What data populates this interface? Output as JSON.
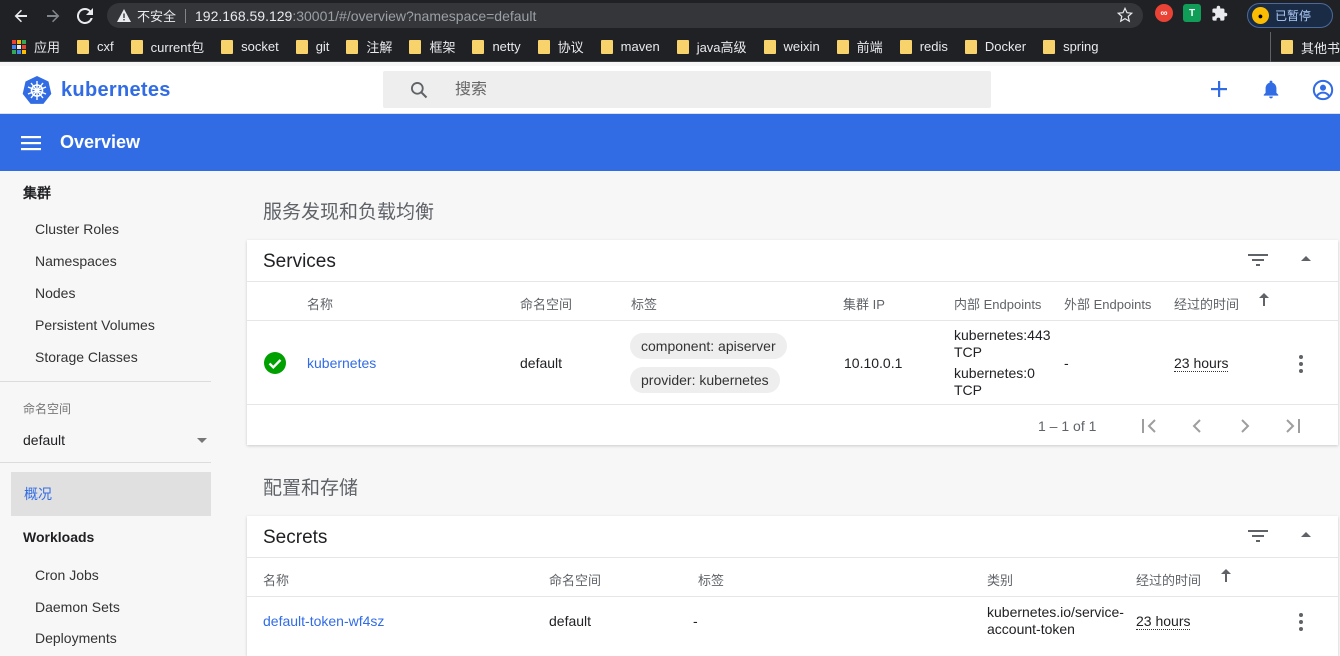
{
  "browser": {
    "not_secure": "不安全",
    "url_host": "192.168.59.129",
    "url_rest": ":30001/#/overview?namespace=default",
    "profile_label": "已暂停",
    "bookmarks": [
      "应用",
      "cxf",
      "current包",
      "socket",
      "git",
      "注解",
      "框架",
      "netty",
      "协议",
      "maven",
      "java高级",
      "weixin",
      "前端",
      "redis",
      "Docker",
      "spring"
    ],
    "other_bookmarks": "其他书"
  },
  "header": {
    "logo_text": "kubernetes",
    "search_placeholder": "搜索"
  },
  "toolbar": {
    "title": "Overview"
  },
  "sidebar": {
    "cluster_heading": "集群",
    "cluster_items": [
      "Cluster Roles",
      "Namespaces",
      "Nodes",
      "Persistent Volumes",
      "Storage Classes"
    ],
    "namespace_label": "命名空间",
    "namespace_value": "default",
    "overview": "概况",
    "workloads_heading": "Workloads",
    "workload_items": [
      "Cron Jobs",
      "Daemon Sets",
      "Deployments"
    ]
  },
  "main": {
    "section1_title": "服务发现和负载均衡",
    "services": {
      "title": "Services",
      "columns": [
        "名称",
        "命名空间",
        "标签",
        "集群 IP",
        "内部 Endpoints",
        "外部 Endpoints",
        "经过的时间"
      ],
      "rows": [
        {
          "name": "kubernetes",
          "namespace": "default",
          "labels": [
            "component: apiserver",
            "provider: kubernetes"
          ],
          "cluster_ip": "10.10.0.1",
          "internal_endpoints": [
            "kubernetes:443",
            "TCP",
            "kubernetes:0",
            "TCP"
          ],
          "external_endpoints": "-",
          "age": "23 hours"
        }
      ],
      "pagination": "1 – 1 of 1"
    },
    "section2_title": "配置和存储",
    "secrets": {
      "title": "Secrets",
      "columns": [
        "名称",
        "命名空间",
        "标签",
        "类别",
        "经过的时间"
      ],
      "rows": [
        {
          "name": "default-token-wf4sz",
          "namespace": "default",
          "labels": "-",
          "type_line1": "kubernetes.io/service-",
          "type_line2": "account-token",
          "age": "23 hours"
        }
      ]
    }
  },
  "colors": {
    "brand": "#326ce5",
    "success": "#00a000"
  }
}
